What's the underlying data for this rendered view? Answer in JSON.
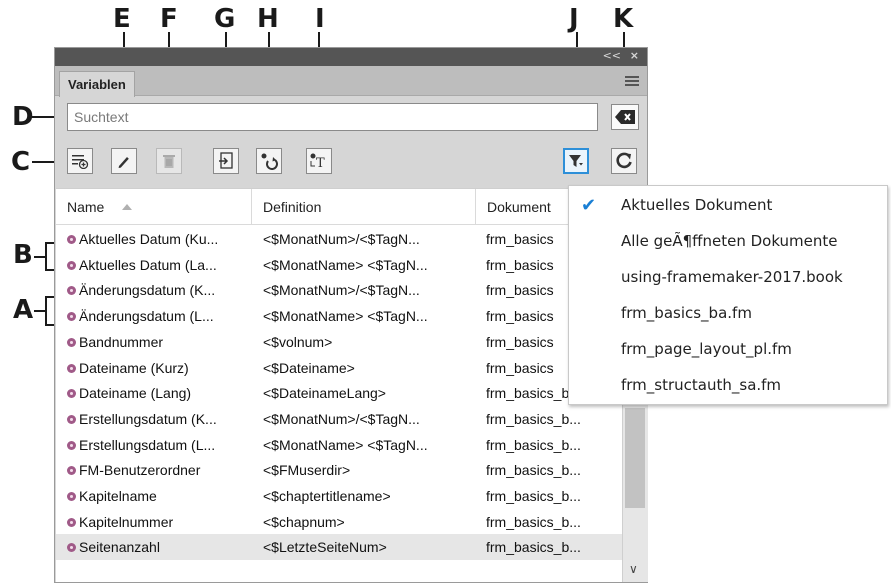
{
  "callouts": {
    "A": "A",
    "B": "B",
    "C": "C",
    "D": "D",
    "E": "E",
    "F": "F",
    "G": "G",
    "H": "H",
    "I": "I",
    "J": "J",
    "K": "K"
  },
  "panel": {
    "collapse_glyph": "<<",
    "close_glyph": "×",
    "tab_label": "Variablen"
  },
  "search": {
    "placeholder": "Suchtext"
  },
  "toolbar": {
    "buttons": [
      {
        "icon": "new-variable-icon"
      },
      {
        "icon": "edit-pencil-icon"
      },
      {
        "icon": "delete-trash-icon"
      },
      {
        "icon": "insert-variable-icon"
      },
      {
        "icon": "convert-to-text-icon"
      },
      {
        "icon": "variable-text-icon"
      },
      {
        "icon": "filter-icon"
      },
      {
        "icon": "refresh-icon"
      }
    ]
  },
  "list": {
    "columns": [
      "Name",
      "Definition",
      "Dokument"
    ],
    "rows": [
      {
        "name": "Aktuelles Datum (Ku...",
        "definition": "<$MonatNum>/<$TagN...",
        "document": "frm_basics"
      },
      {
        "name": "Aktuelles Datum (La...",
        "definition": "<$MonatName> <$TagN...",
        "document": "frm_basics"
      },
      {
        "name": "Änderungsdatum (K...",
        "definition": "<$MonatNum>/<$TagN...",
        "document": "frm_basics"
      },
      {
        "name": "Änderungsdatum (L...",
        "definition": "<$MonatName> <$TagN...",
        "document": "frm_basics"
      },
      {
        "name": "Bandnummer",
        "definition": "<$volnum>",
        "document": "frm_basics"
      },
      {
        "name": "Dateiname (Kurz)",
        "definition": "<$Dateiname>",
        "document": "frm_basics"
      },
      {
        "name": "Dateiname (Lang)",
        "definition": "<$DateinameLang>",
        "document": "frm_basics_b..."
      },
      {
        "name": "Erstellungsdatum (K...",
        "definition": "<$MonatNum>/<$TagN...",
        "document": "frm_basics_b..."
      },
      {
        "name": "Erstellungsdatum (L...",
        "definition": "<$MonatName> <$TagN...",
        "document": "frm_basics_b..."
      },
      {
        "name": "FM-Benutzerordner",
        "definition": "<$FMuserdir>",
        "document": "frm_basics_b..."
      },
      {
        "name": "Kapitelname",
        "definition": "<$chaptertitlename>",
        "document": "frm_basics_b..."
      },
      {
        "name": "Kapitelnummer",
        "definition": "<$chapnum>",
        "document": "frm_basics_b..."
      },
      {
        "name": "Seitenanzahl",
        "definition": "<$LetzteSeiteNum>",
        "document": "frm_basics_b..."
      }
    ]
  },
  "dropdown": {
    "check_glyph": "✔",
    "items": [
      "Aktuelles Dokument",
      "Alle geÃ¶ffneten Dokumente",
      "using-framemaker-2017.book",
      "frm_basics_ba.fm",
      "frm_page_layout_pl.fm",
      "frm_structauth_sa.fm"
    ]
  },
  "colors": {
    "accent": "#2d8fd8",
    "variable_icon": "#a05a88"
  }
}
